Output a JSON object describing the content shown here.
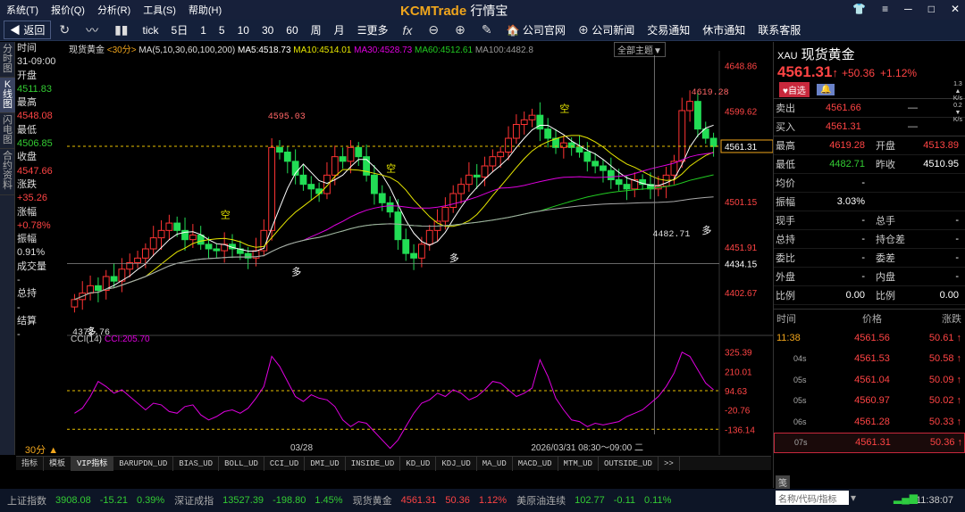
{
  "menu": {
    "items": [
      "系统(T)",
      "报价(Q)",
      "分析(R)",
      "工具(S)",
      "帮助(H)"
    ],
    "logo_brand": "KCMTrade",
    "logo_sub": "行情宝"
  },
  "toolbar": {
    "back": "返回",
    "tick": "tick",
    "periods": [
      "5日",
      "1",
      "5",
      "10",
      "30",
      "60",
      "周",
      "月"
    ],
    "more": "更多",
    "links": [
      "公司官网",
      "公司新闻",
      "交易通知",
      "休市通知",
      "联系客服"
    ]
  },
  "lefttabs": [
    "分时图",
    "K线图",
    "闪电图",
    "合约资料"
  ],
  "info": {
    "time_label": "时间",
    "time_value": "31-09:00",
    "open_label": "开盘",
    "open_value": "4511.83",
    "high_label": "最高",
    "high_value": "4548.08",
    "low_label": "最低",
    "low_value": "4506.85",
    "close_label": "收盘",
    "close_value": "4547.66",
    "chg_label": "涨跌",
    "chg_value": "+35.26",
    "pct_label": "涨幅",
    "pct_value": "+0.78%",
    "amp_label": "振幅",
    "amp_value": "0.91%",
    "vol_label": "成交量",
    "vol_value": "-",
    "oi_label": "总持",
    "oi_value": "-",
    "settle_label": "结算",
    "settle_value": "-"
  },
  "chart_header": {
    "name": "现货黄金",
    "period": "<30分>",
    "ma_params": "MA(5,10,30,60,100,200)",
    "ma5": "MA5:4518.73",
    "ma10": "MA10:4514.01",
    "ma30": "MA30:4528.73",
    "ma60": "MA60:4512.61",
    "ma100": "MA100:4482.8",
    "theme_btn": "全部主题▼"
  },
  "chart_data": {
    "type": "candlestick",
    "y_ticks": [
      "4648.86",
      "4599.62",
      "4501.15",
      "4451.91",
      "4402.67"
    ],
    "current_price_tag": "4561.31",
    "crosshair_price_tag": "4434.15",
    "high_label": "4619.28",
    "low_label": "4482.71",
    "mark_high_mid": "4595.03",
    "mark_low_first": "4372.76",
    "signals": {
      "kong": "空",
      "duo": "多"
    },
    "date_label": "03/28",
    "cursor_label": "2026/03/31 08:30～09:00 二",
    "closes": [
      4395,
      4402,
      4410,
      4405,
      4420,
      4415,
      4428,
      4435,
      4440,
      4450,
      4462,
      4470,
      4478,
      4470,
      4460,
      4465,
      4455,
      4450,
      4448,
      4455,
      4450,
      4445,
      4440,
      4448,
      4470,
      4560,
      4555,
      4545,
      4530,
      4520,
      4515,
      4510,
      4530,
      4550,
      4545,
      4560,
      4550,
      4530,
      4510,
      4500,
      4490,
      4460,
      4445,
      4440,
      4455,
      4470,
      4480,
      4495,
      4510,
      4520,
      4530,
      4528,
      4540,
      4550,
      4555,
      4570,
      4585,
      4590,
      4595,
      4580,
      4570,
      4560,
      4565,
      4560,
      4555,
      4545,
      4540,
      4535,
      4525,
      4520,
      4515,
      4525,
      4520,
      4515,
      4518,
      4530,
      4545,
      4600,
      4610,
      4580,
      4570,
      4561
    ],
    "cci": {
      "label": "CCI(14)",
      "value_label": "CCI:205.70",
      "y_ticks": [
        "325.39",
        "210.01",
        "94.63",
        "-20.76",
        "-136.14"
      ],
      "values": [
        -40,
        -10,
        60,
        150,
        120,
        80,
        100,
        60,
        20,
        -20,
        20,
        10,
        -30,
        -40,
        0,
        10,
        -50,
        -80,
        -60,
        -30,
        -20,
        -40,
        -10,
        50,
        120,
        300,
        240,
        150,
        60,
        30,
        70,
        50,
        40,
        0,
        -80,
        -120,
        -90,
        -100,
        -150,
        -200,
        -250,
        -200,
        -120,
        -40,
        20,
        40,
        80,
        60,
        100,
        80,
        40,
        60,
        100,
        150,
        140,
        100,
        60,
        80,
        110,
        280,
        180,
        50,
        -20,
        -80,
        -90,
        -120,
        -100,
        -110,
        -100,
        -90,
        -60,
        -40,
        -20,
        20,
        60,
        120,
        200,
        325,
        300,
        220,
        140,
        100
      ]
    }
  },
  "period_btn": "30分 ▲",
  "bottomtabs": [
    "指标",
    "模板",
    "VIP指标",
    "BARUPDN_UD",
    "BIAS_UD",
    "BOLL_UD",
    "CCI_UD",
    "DMI_UD",
    "INSIDE_UD",
    "KD_UD",
    "KDJ_UD",
    "MA_UD",
    "MACD_UD",
    "MTM_UD",
    "OUTSIDE_UD",
    ">>"
  ],
  "quote": {
    "code": "XAU",
    "name": "现货黄金",
    "price": "4561.31",
    "arrow": "↑",
    "change": "+50.36",
    "pct": "+1.12%",
    "speed_up": "1.3",
    "speed_dn": "0.2",
    "speed_unit": "K/s",
    "add_btn": "自选",
    "sell_label": "卖出",
    "sell_value": "4561.66",
    "sell_vol": "—",
    "buy_label": "买入",
    "buy_value": "4561.31",
    "buy_vol": "—",
    "rows": [
      [
        "最高",
        "4619.28",
        "开盘",
        "4513.89"
      ],
      [
        "最低",
        "4482.71",
        "昨收",
        "4510.95"
      ],
      [
        "均价",
        "-",
        "",
        ""
      ],
      [
        "振幅",
        "3.03%",
        "",
        ""
      ],
      [
        "现手",
        "-",
        "总手",
        "-"
      ],
      [
        "总持",
        "-",
        "持仓差",
        "-"
      ],
      [
        "委比",
        "-",
        "委差",
        "-"
      ],
      [
        "外盘",
        "-",
        "内盘",
        "-"
      ],
      [
        "比例",
        "0.00",
        "比例",
        "0.00"
      ]
    ],
    "ticks_header": [
      "时间",
      "价格",
      "涨跌"
    ],
    "ticks": [
      [
        "11:38",
        "4561.56",
        "50.61 ↑"
      ],
      [
        "04s",
        "4561.53",
        "50.58 ↑"
      ],
      [
        "05s",
        "4561.04",
        "50.09 ↑"
      ],
      [
        "05s",
        "4560.97",
        "50.02 ↑"
      ],
      [
        "06s",
        "4561.28",
        "50.33 ↑"
      ],
      [
        "07s",
        "4561.31",
        "50.36 ↑"
      ]
    ],
    "rp_tab": "笺",
    "search_placeholder": "名称/代码/指标"
  },
  "status": {
    "items": [
      {
        "name": "上证指数",
        "val": "3908.08",
        "chg": "-15.21",
        "pct": "0.39%"
      },
      {
        "name": "深证成指",
        "val": "13527.39",
        "chg": "-198.80",
        "pct": "1.45%"
      },
      {
        "name": "现货黄金",
        "val": "4561.31",
        "chg": "50.36",
        "pct": "1.12%"
      },
      {
        "name": "美原油连续",
        "val": "102.77",
        "chg": "-0.11",
        "pct": "0.11%"
      }
    ],
    "time": "11:38:07"
  }
}
